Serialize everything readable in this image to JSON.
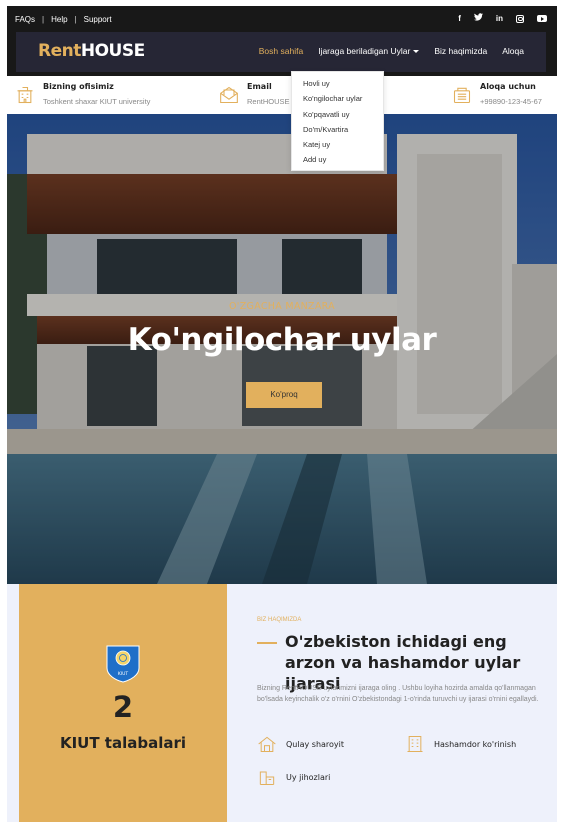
{
  "topbar": {
    "links": [
      "FAQs",
      "Help",
      "Support"
    ],
    "social_icons": [
      "facebook-icon",
      "twitter-icon",
      "linkedin-icon",
      "instagram-icon",
      "youtube-icon"
    ]
  },
  "brand": {
    "part1": "Rent",
    "part2": "HOUSE",
    "accent_color": "#e2b05d"
  },
  "nav": {
    "items": [
      "Bosh sahifa",
      "Ijaraga beriladigan Uylar",
      "Biz haqimizda",
      "Aloqa"
    ],
    "dropdown": [
      "Hovli uy",
      "Ko'ngilochar uylar",
      "Ko'pqavatli uy",
      "Do'm/Kvartira",
      "Katej uy",
      "Add uy"
    ]
  },
  "info": {
    "office_title": "Bizning ofisimiz",
    "office_value": "Toshkent shaxar KIUT university",
    "email_title": "Email",
    "email_value": "RentHOUSE",
    "contact_title": "Aloqa uchun",
    "contact_value": "+99890-123-45-67"
  },
  "hero": {
    "kicker": "O'ZGACHA MANZARA",
    "title": "Ko'ngilochar uylar",
    "button": "Ko'proq"
  },
  "about": {
    "stat_number": "2",
    "stat_label": "KIUT talabalari",
    "badge_text": "KIUT",
    "kicker": "BIZ HAQIMIZDA",
    "heading": "O'zbekiston ichidagi eng arzon va hashamdor uylar ijarasi",
    "paragraph": "Bizning RentHOUSE uylarimizni ijaraga oling . Ushbu loyiha hozirda amalda qo'llanmagan bo'lsada keyinchalik o'z o'rnini O'zbekistondagi 1-o'rinda turuvchi uy ijarasi o'rnini egallaydi.",
    "features": [
      "Qulay sharoyit",
      "Hashamdor ko'rinish",
      "Uy jihozlari"
    ]
  }
}
